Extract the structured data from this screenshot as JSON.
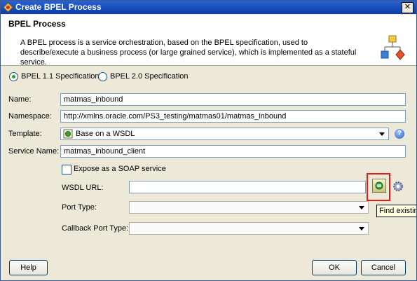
{
  "window": {
    "title": "Create BPEL Process"
  },
  "header": {
    "title": "BPEL Process",
    "description": "A BPEL process is a service orchestration, based on the BPEL specification, used to describe/execute a business process (or large grained service), which is implemented as a stateful service."
  },
  "spec": {
    "option1": "BPEL 1.1 Specification",
    "option2": "BPEL 2.0 Specification",
    "selected": "BPEL 1.1 Specification"
  },
  "form": {
    "name_label": "Name:",
    "name_value": "matmas_inbound",
    "namespace_label": "Namespace:",
    "namespace_value": "http://xmlns.oracle.com/PS3_testing/matmas01/matmas_inbound",
    "template_label": "Template:",
    "template_value": "Base on a WSDL",
    "service_name_label": "Service Name:",
    "service_name_value": "matmas_inbound_client",
    "expose_soap_label": "Expose as a SOAP service",
    "wsdl_url_label": "WSDL URL:",
    "wsdl_url_value": "",
    "port_type_label": "Port Type:",
    "callback_port_type_label": "Callback Port Type:"
  },
  "tooltip": {
    "text": "Find existin"
  },
  "buttons": {
    "help": "Help",
    "ok": "OK",
    "cancel": "Cancel"
  },
  "colors": {
    "titlebar": "#174cb8",
    "highlight_border": "#e21a1a",
    "dialog_bg": "#ece9d8"
  }
}
